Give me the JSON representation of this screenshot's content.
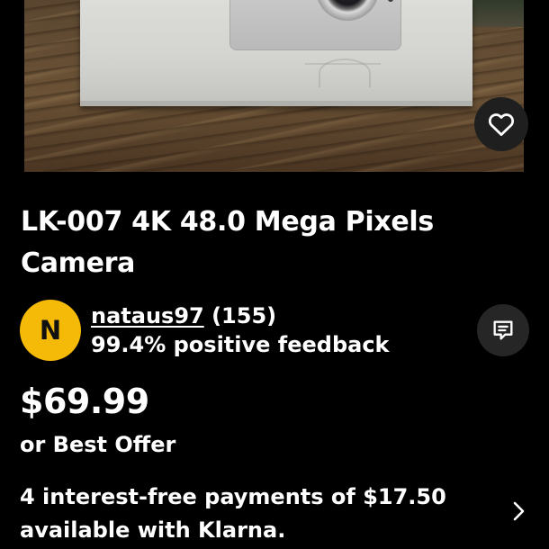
{
  "listing": {
    "title": "LK-007 4K 48.0 Mega Pixels Camera",
    "price": "$69.99",
    "best_offer": "or Best Offer"
  },
  "seller": {
    "avatar_initial": "N",
    "avatar_color": "#f5b908",
    "name": "nataus97",
    "rating_count": "(155)",
    "feedback": "99.4% positive feedback"
  },
  "klarna": {
    "line1": "4 interest-free payments of $17.50",
    "line2_prefix": "available with ",
    "brand": "Klarna",
    "line2_suffix": "."
  },
  "icons": {
    "favorite": "heart-icon",
    "message": "message-icon",
    "more": "chevron-right-icon"
  }
}
